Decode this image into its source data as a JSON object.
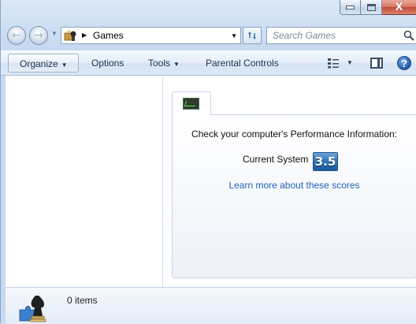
{
  "window": {
    "caption_buttons": {
      "close_glyph": "X"
    }
  },
  "addressbar": {
    "path": "Games",
    "icon": "games-folder-icon"
  },
  "search": {
    "placeholder": "Search Games"
  },
  "toolbar": {
    "organize": "Organize",
    "options": "Options",
    "tools": "Tools",
    "parental_controls": "Parental Controls"
  },
  "performance": {
    "heading": "Check your computer's Performance Information:",
    "current_label": "Current System",
    "score": "3.5",
    "learn_more": "Learn more about these scores",
    "score_color": "#2c6fb1"
  },
  "details": {
    "item_count": "0 items",
    "icon": "games-chess-puzzle-icon"
  }
}
